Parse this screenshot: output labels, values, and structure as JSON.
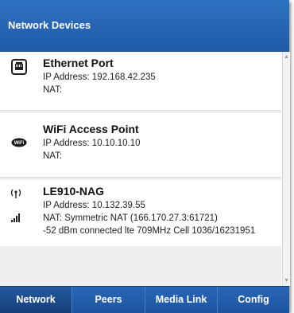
{
  "window": {
    "title": "Network Devices"
  },
  "devices": [
    {
      "name": "Ethernet Port",
      "icon": "ethernet-port-icon",
      "lines": [
        "IP Address: 192.168.42.235",
        "NAT:"
      ]
    },
    {
      "name": "WiFi Access Point",
      "icon": "wifi-icon",
      "lines": [
        "IP Address: 10.10.10.10",
        "NAT:"
      ]
    },
    {
      "name": "LE910-NAG",
      "icon": "cellular-antenna-icon",
      "icon2": "signal-strength-icon",
      "lines": [
        "IP Address: 10.132.39.55",
        "NAT: Symmetric NAT (166.170.27.3:61721)",
        "-52 dBm connected lte 709MHz Cell 1036/16231951"
      ]
    }
  ],
  "tabs": [
    {
      "label": "Network",
      "active": true
    },
    {
      "label": "Peers",
      "active": false
    },
    {
      "label": "Media Link",
      "active": false
    },
    {
      "label": "Config",
      "active": false
    }
  ],
  "colors": {
    "accent": "#1f5aa6",
    "list_bg": "#efefef"
  }
}
